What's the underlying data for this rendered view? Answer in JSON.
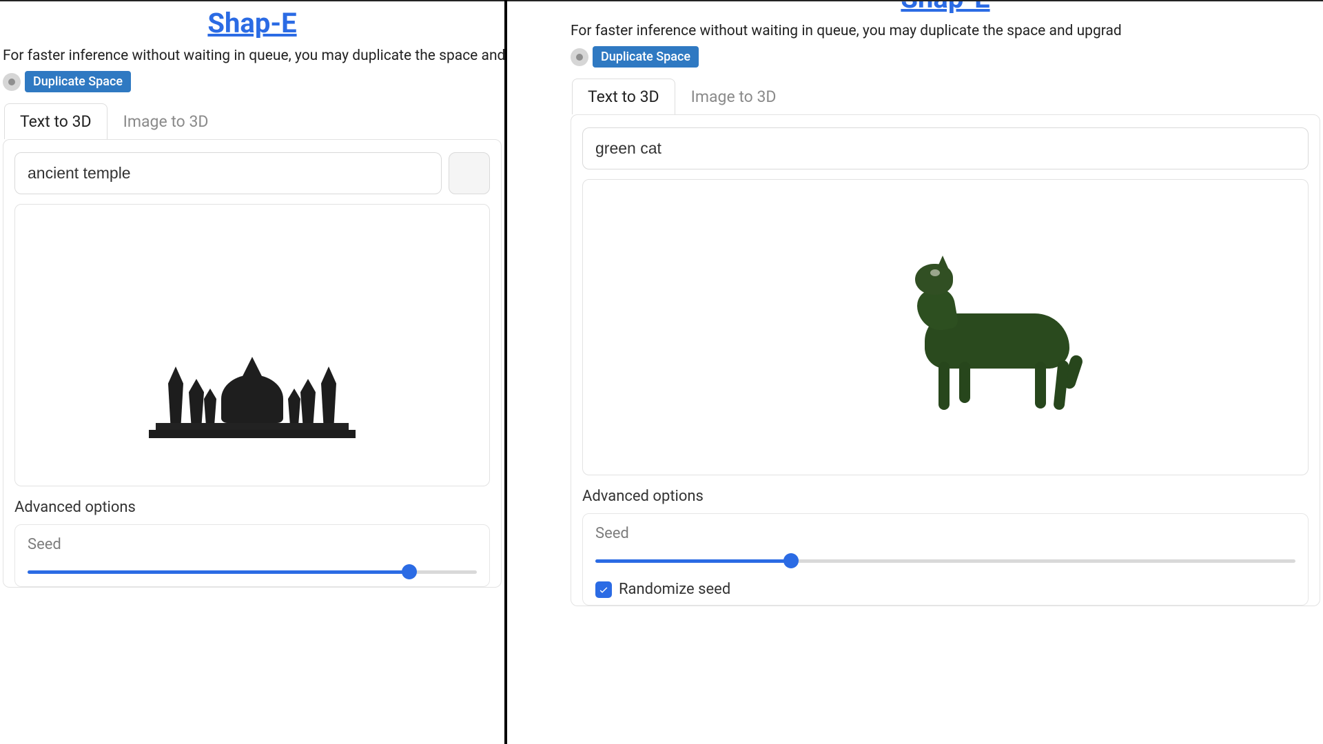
{
  "left": {
    "title": "Shap-E",
    "subtitle": "For faster inference without waiting in queue, you may duplicate the space and upgrade to GPU in se",
    "duplicate_label": "Duplicate Space",
    "tabs": {
      "text_to_3d": "Text to 3D",
      "image_to_3d": "Image to 3D"
    },
    "prompt_value": "ancient temple",
    "advanced_title": "Advanced options",
    "seed_label": "Seed",
    "seed_fill_pct": 85
  },
  "right": {
    "title": "Shap-E",
    "subtitle": "For faster inference without waiting in queue, you may duplicate the space and upgrad",
    "duplicate_label": "Duplicate Space",
    "tabs": {
      "text_to_3d": "Text to 3D",
      "image_to_3d": "Image to 3D"
    },
    "prompt_value": "green cat",
    "advanced_title": "Advanced options",
    "seed_label": "Seed",
    "seed_fill_pct": 28,
    "randomize_label": "Randomize seed"
  }
}
